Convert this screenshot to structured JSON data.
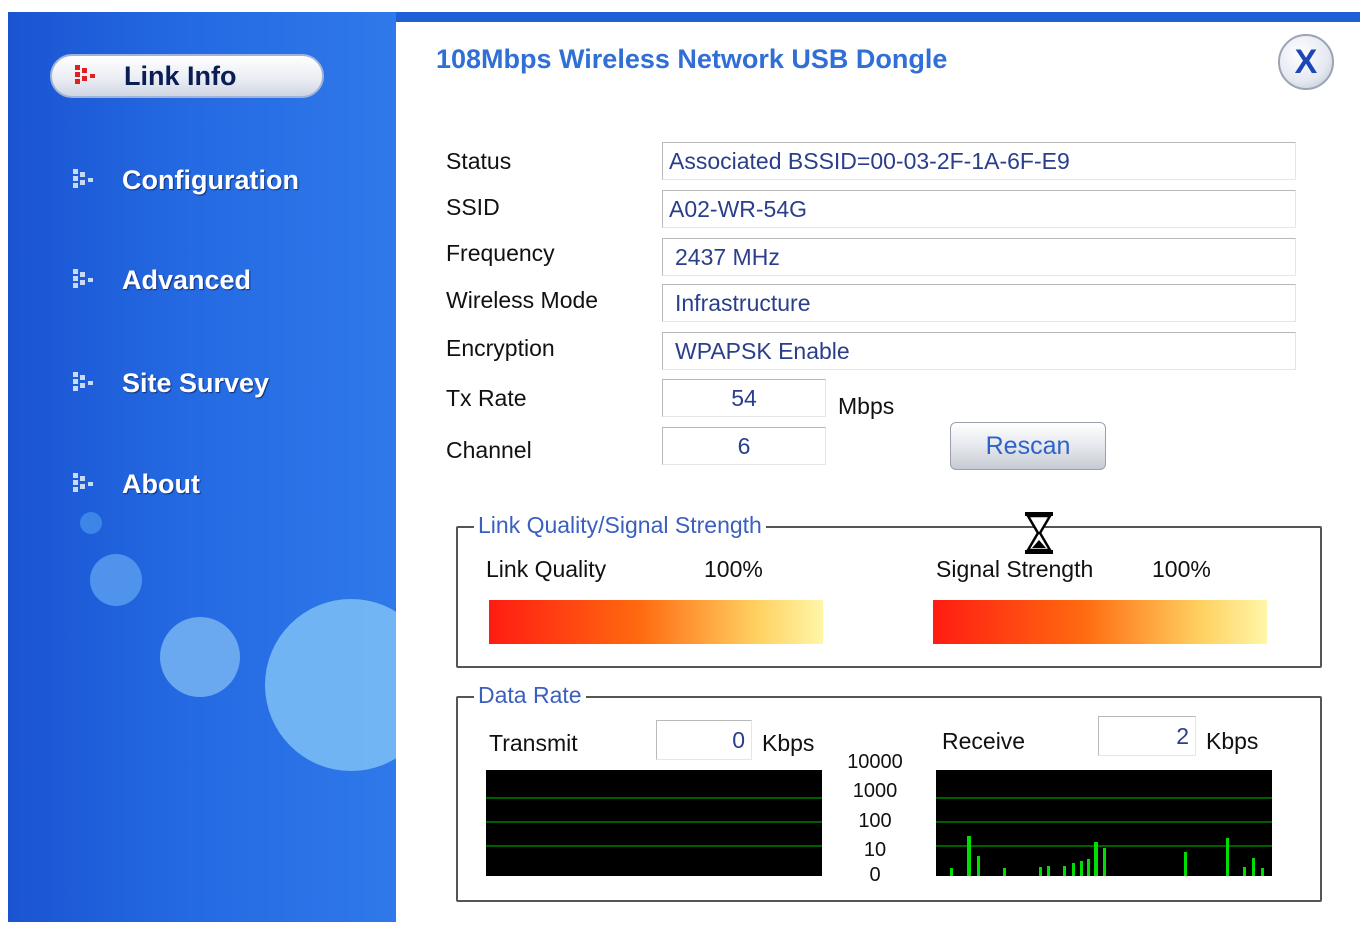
{
  "window": {
    "title": "108Mbps Wireless Network USB Dongle",
    "close_label": "X"
  },
  "sidebar": {
    "items": [
      {
        "label": "Link Info",
        "active": true
      },
      {
        "label": "Configuration",
        "active": false
      },
      {
        "label": "Advanced",
        "active": false
      },
      {
        "label": "Site Survey",
        "active": false
      },
      {
        "label": "About",
        "active": false
      }
    ]
  },
  "link_info": {
    "status": {
      "label": "Status",
      "value": "Associated BSSID=00-03-2F-1A-6F-E9"
    },
    "ssid": {
      "label": "SSID",
      "value": "A02-WR-54G"
    },
    "frequency": {
      "label": "Frequency",
      "value": "2437 MHz"
    },
    "wireless_mode": {
      "label": "Wireless Mode",
      "value": "Infrastructure"
    },
    "encryption": {
      "label": "Encryption",
      "value": "WPAPSK Enable"
    },
    "tx_rate": {
      "label": "Tx Rate",
      "value": "54",
      "unit": "Mbps"
    },
    "channel": {
      "label": "Channel",
      "value": "6"
    },
    "rescan_label": "Rescan"
  },
  "signal": {
    "group_label": "Link Quality/Signal Strength",
    "link_quality": {
      "label": "Link Quality",
      "value_text": "100%",
      "value": 100
    },
    "signal_strength": {
      "label": "Signal Strength",
      "value_text": "100%",
      "value": 100
    }
  },
  "data_rate": {
    "group_label": "Data Rate",
    "transmit": {
      "label": "Transmit",
      "value": "0",
      "unit": "Kbps"
    },
    "receive": {
      "label": "Receive",
      "value": "2",
      "unit": "Kbps"
    },
    "scale_labels": [
      "10000",
      "1000",
      "100",
      "10",
      "0"
    ]
  },
  "colors": {
    "accent": "#2f6fd6",
    "sidebar": "#2469e2",
    "graph_line": "#00c800"
  }
}
